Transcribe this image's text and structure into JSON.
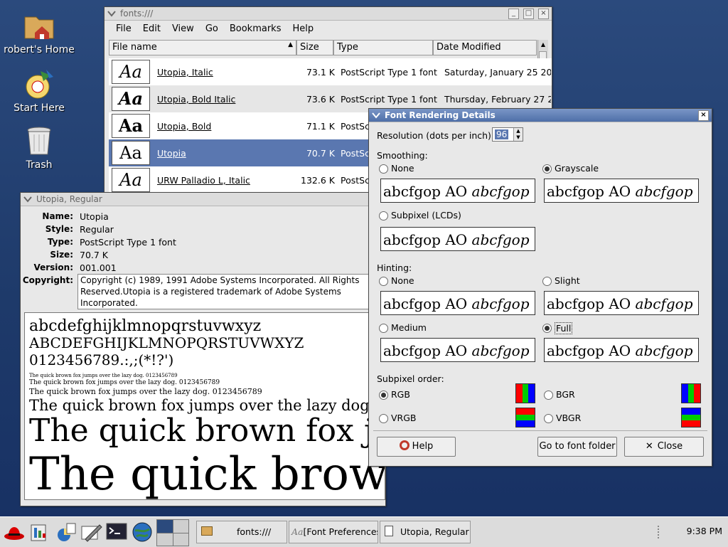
{
  "desktop": {
    "icons": [
      {
        "label": "robert's Home",
        "icon": "home-folder-icon"
      },
      {
        "label": "Start Here",
        "icon": "start-here-icon"
      },
      {
        "label": "Trash",
        "icon": "trash-icon"
      }
    ]
  },
  "fonts_window": {
    "title": "fonts:///",
    "menu": [
      "File",
      "Edit",
      "View",
      "Go",
      "Bookmarks",
      "Help"
    ],
    "columns": [
      "File name",
      "Size",
      "Type",
      "Date Modified"
    ],
    "rows": [
      {
        "preview": "Aa",
        "name": "Utopia, Italic",
        "size": "73.1 K",
        "type": "PostScript Type 1 font",
        "date": "Saturday, January 25 20"
      },
      {
        "preview": "Aa",
        "name": "Utopia, Bold Italic",
        "size": "73.6 K",
        "type": "PostScript Type 1 font",
        "date": "Thursday, February 27 2"
      },
      {
        "preview": "Aa",
        "name": "Utopia, Bold",
        "size": "71.1 K",
        "type": "PostScri",
        "date": ""
      },
      {
        "preview": "Aa",
        "name": "Utopia",
        "size": "70.7 K",
        "type": "PostScri",
        "date": ""
      },
      {
        "preview": "Aa",
        "name": "URW Palladio L, Italic",
        "size": "132.6 K",
        "type": "PostScri",
        "date": ""
      }
    ]
  },
  "details_window": {
    "title": "Utopia, Regular",
    "fields": [
      {
        "key": "Name:",
        "value": "Utopia"
      },
      {
        "key": "Style:",
        "value": "Regular"
      },
      {
        "key": "Type:",
        "value": "PostScript Type 1 font"
      },
      {
        "key": "Size:",
        "value": "70.7 K"
      },
      {
        "key": "Version:",
        "value": "001.001"
      }
    ],
    "copyright_key": "Copyright:",
    "copyright_lines": [
      "Copyright (c) 1989, 1991 Adobe Systems Incorporated.  All Rights",
      "Reserved.Utopia is a registered trademark of Adobe Systems",
      "Incorporated."
    ],
    "sample_lines": [
      "abcdefghijklmnopqrstuvwxyz",
      "ABCDEFGHIJKLMNOPQRSTUVWXYZ",
      "0123456789.:,;(*!?')",
      "The quick brown fox jumps over the lazy dog. 0123456789",
      "The quick brown fox jumps over the lazy dog. 0123456789",
      "The quick brown fox jumps over the lazy dog. 0123456789",
      "The quick brown fox jumps over the lazy dog",
      "The quick brown fox ju",
      "The quick brow"
    ]
  },
  "render_dialog": {
    "title": "Font Rendering Details",
    "resolution_label": "Resolution (dots per inch):",
    "resolution_value": "96",
    "smoothing_label": "Smoothing:",
    "smoothing": [
      {
        "label": "None",
        "checked": false
      },
      {
        "label": "Grayscale",
        "checked": true
      },
      {
        "label": "Subpixel (LCDs)",
        "checked": false
      }
    ],
    "hinting_label": "Hinting:",
    "hinting": [
      {
        "label": "None",
        "checked": false
      },
      {
        "label": "Slight",
        "checked": false
      },
      {
        "label": "Medium",
        "checked": false
      },
      {
        "label": "Full",
        "checked": true
      }
    ],
    "demo_text": "abcfgop AO ",
    "demo_italic": "abcfgop",
    "subpixel_label": "Subpixel order:",
    "subpixel": [
      {
        "label": "RGB",
        "checked": true,
        "colors": [
          "#ff0000",
          "#00cc00",
          "#0000ff"
        ]
      },
      {
        "label": "BGR",
        "checked": false,
        "colors": [
          "#0000ff",
          "#00cc00",
          "#ff0000"
        ]
      },
      {
        "label": "VRGB",
        "checked": false,
        "colors": [
          "#ff0000",
          "#00cc00",
          "#0000ff"
        ]
      },
      {
        "label": "VBGR",
        "checked": false,
        "colors": [
          "#0000ff",
          "#00cc00",
          "#ff0000"
        ]
      }
    ],
    "buttons": {
      "help": "Help",
      "font_folder": "Go to font folder",
      "close": "Close"
    }
  },
  "panel": {
    "tasks": [
      "fonts:///",
      "[Font Preferences]",
      "Utopia, Regular"
    ],
    "clock": "9:38 PM"
  }
}
